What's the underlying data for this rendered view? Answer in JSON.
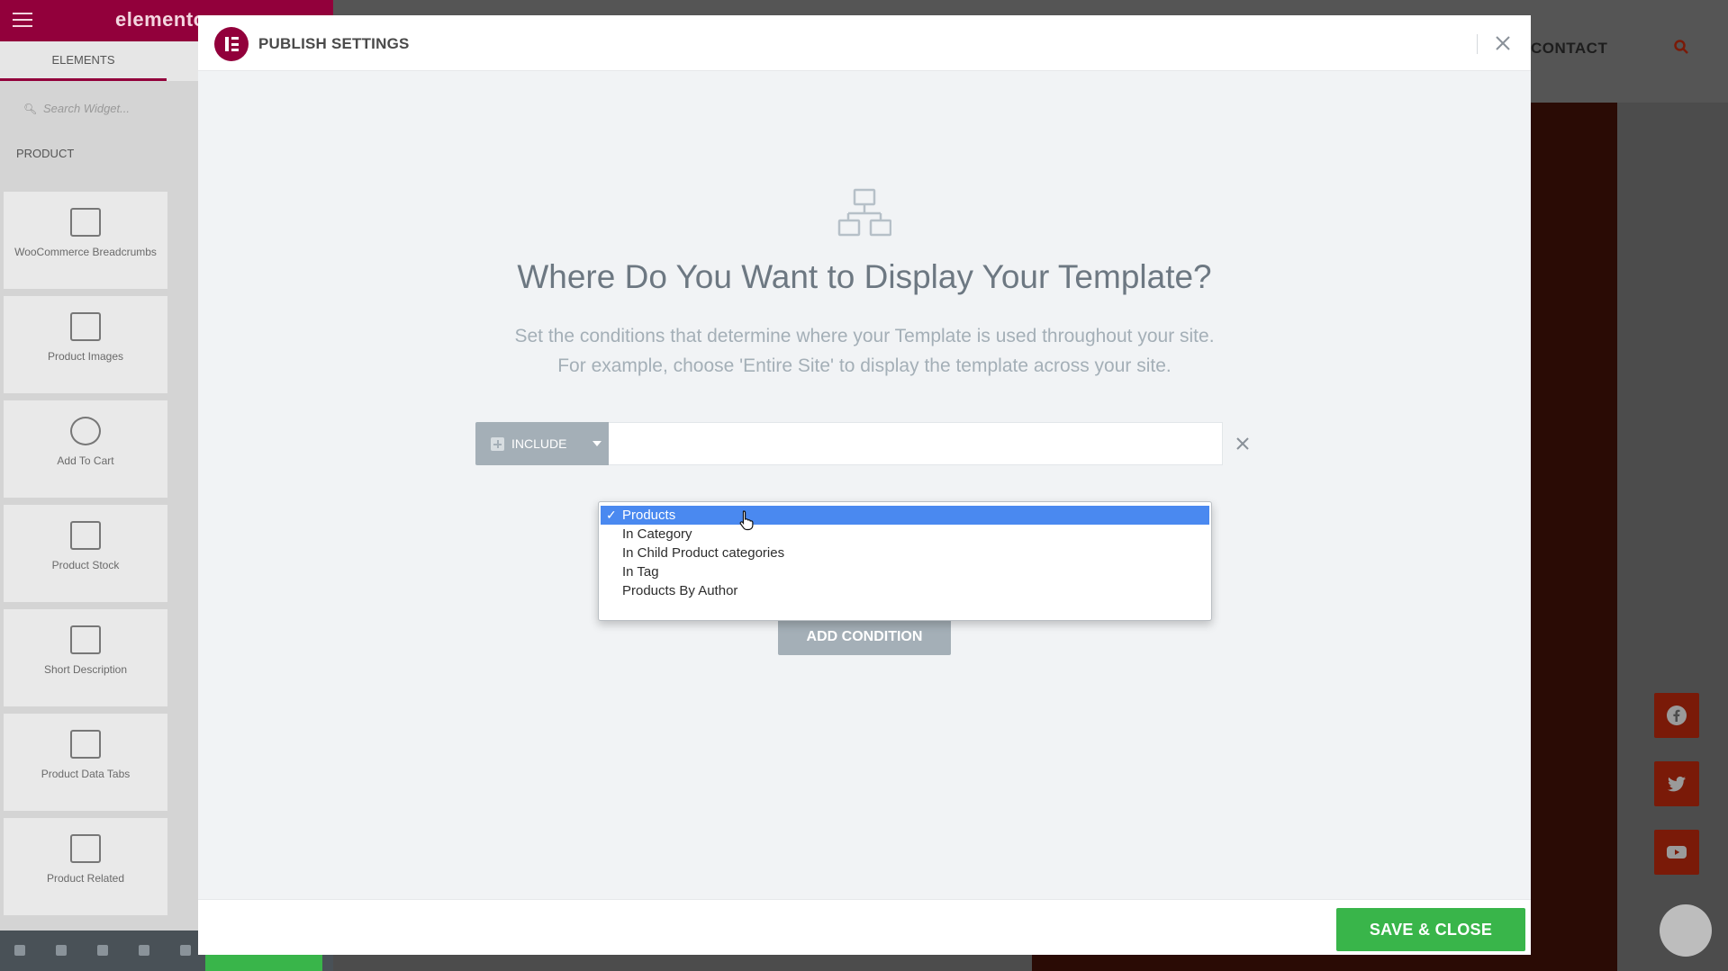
{
  "editor_panel": {
    "logo_text": "elementor",
    "tab_elements": "ELEMENTS",
    "search_placeholder": "Search Widget...",
    "category": "PRODUCT",
    "widgets": [
      {
        "label": "WooCommerce Breadcrumbs"
      },
      {
        "label": "Product Images"
      },
      {
        "label": "Add To Cart"
      },
      {
        "label": "Product Stock"
      },
      {
        "label": "Short Description"
      },
      {
        "label": "Product Data Tabs"
      },
      {
        "label": "Product Related"
      }
    ]
  },
  "site_preview": {
    "nav_contact": "CONTACT",
    "social": [
      "facebook-icon",
      "twitter-icon",
      "youtube-icon"
    ]
  },
  "modal": {
    "title": "PUBLISH SETTINGS",
    "heading": "Where Do You Want to Display Your Template?",
    "subtext_line1": "Set the conditions that determine where your Template is used throughout your site.",
    "subtext_line2": "For example, choose 'Entire Site' to display the template across your site.",
    "condition": {
      "include_label": "INCLUDE",
      "dropdown_options": [
        {
          "label": "Products",
          "selected": true
        },
        {
          "label": "In Category",
          "selected": false
        },
        {
          "label": "In Child Product categories",
          "selected": false
        },
        {
          "label": "In Tag",
          "selected": false
        },
        {
          "label": "Products By Author",
          "selected": false
        }
      ]
    },
    "add_condition_label": "ADD CONDITION",
    "save_close_label": "SAVE & CLOSE"
  },
  "colors": {
    "brand": "#92003b",
    "save_button": "#39b54a",
    "selected_option": "#4a89f0",
    "muted_control": "#a4afb7"
  }
}
